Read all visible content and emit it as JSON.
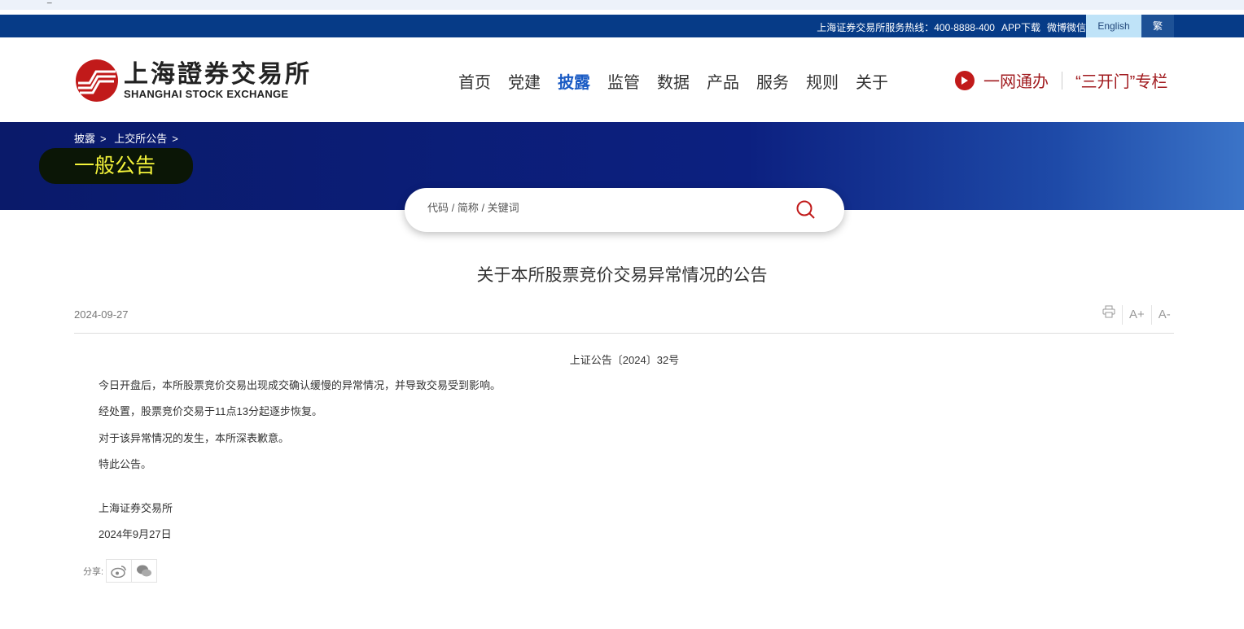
{
  "browser": {
    "mark": "_"
  },
  "topbar": {
    "hotline": "上海证券交易所服务热线：400-8888-400",
    "app": "APP下载",
    "weibo": "微博微信",
    "english": "English",
    "traditional": "繁"
  },
  "logo": {
    "cn": "上海證券交易所",
    "en": "SHANGHAI STOCK EXCHANGE"
  },
  "nav": [
    "首页",
    "党建",
    "披露",
    "监管",
    "数据",
    "产品",
    "服务",
    "规则",
    "关于"
  ],
  "quick": {
    "one": "一网通办",
    "column": "“三开门”专栏"
  },
  "breadcrumb": [
    "披露",
    "上交所公告"
  ],
  "banner_title": "一般公告",
  "search": {
    "placeholder": "代码 / 简称 / 关键词"
  },
  "article": {
    "title": "关于本所股票竞价交易异常情况的公告",
    "date": "2024-09-27",
    "doc_no": "上证公告〔2024〕32号",
    "paragraphs": [
      "今日开盘后，本所股票竞价交易出现成交确认缓慢的异常情况，并导致交易受到影响。",
      "经处置，股票竞价交易于11点13分起逐步恢复。",
      "对于该异常情况的发生，本所深表歉意。",
      "特此公告。"
    ],
    "signer": "上海证券交易所",
    "sign_date": "2024年9月27日"
  },
  "tools": {
    "increase": "A+",
    "decrease": "A-"
  },
  "share": {
    "label": "分享:"
  },
  "colors": {
    "topbar": "#063b87",
    "accent": "#1a5bc4",
    "red": "#a11b1f",
    "title_yellow": "#f4f43a"
  }
}
